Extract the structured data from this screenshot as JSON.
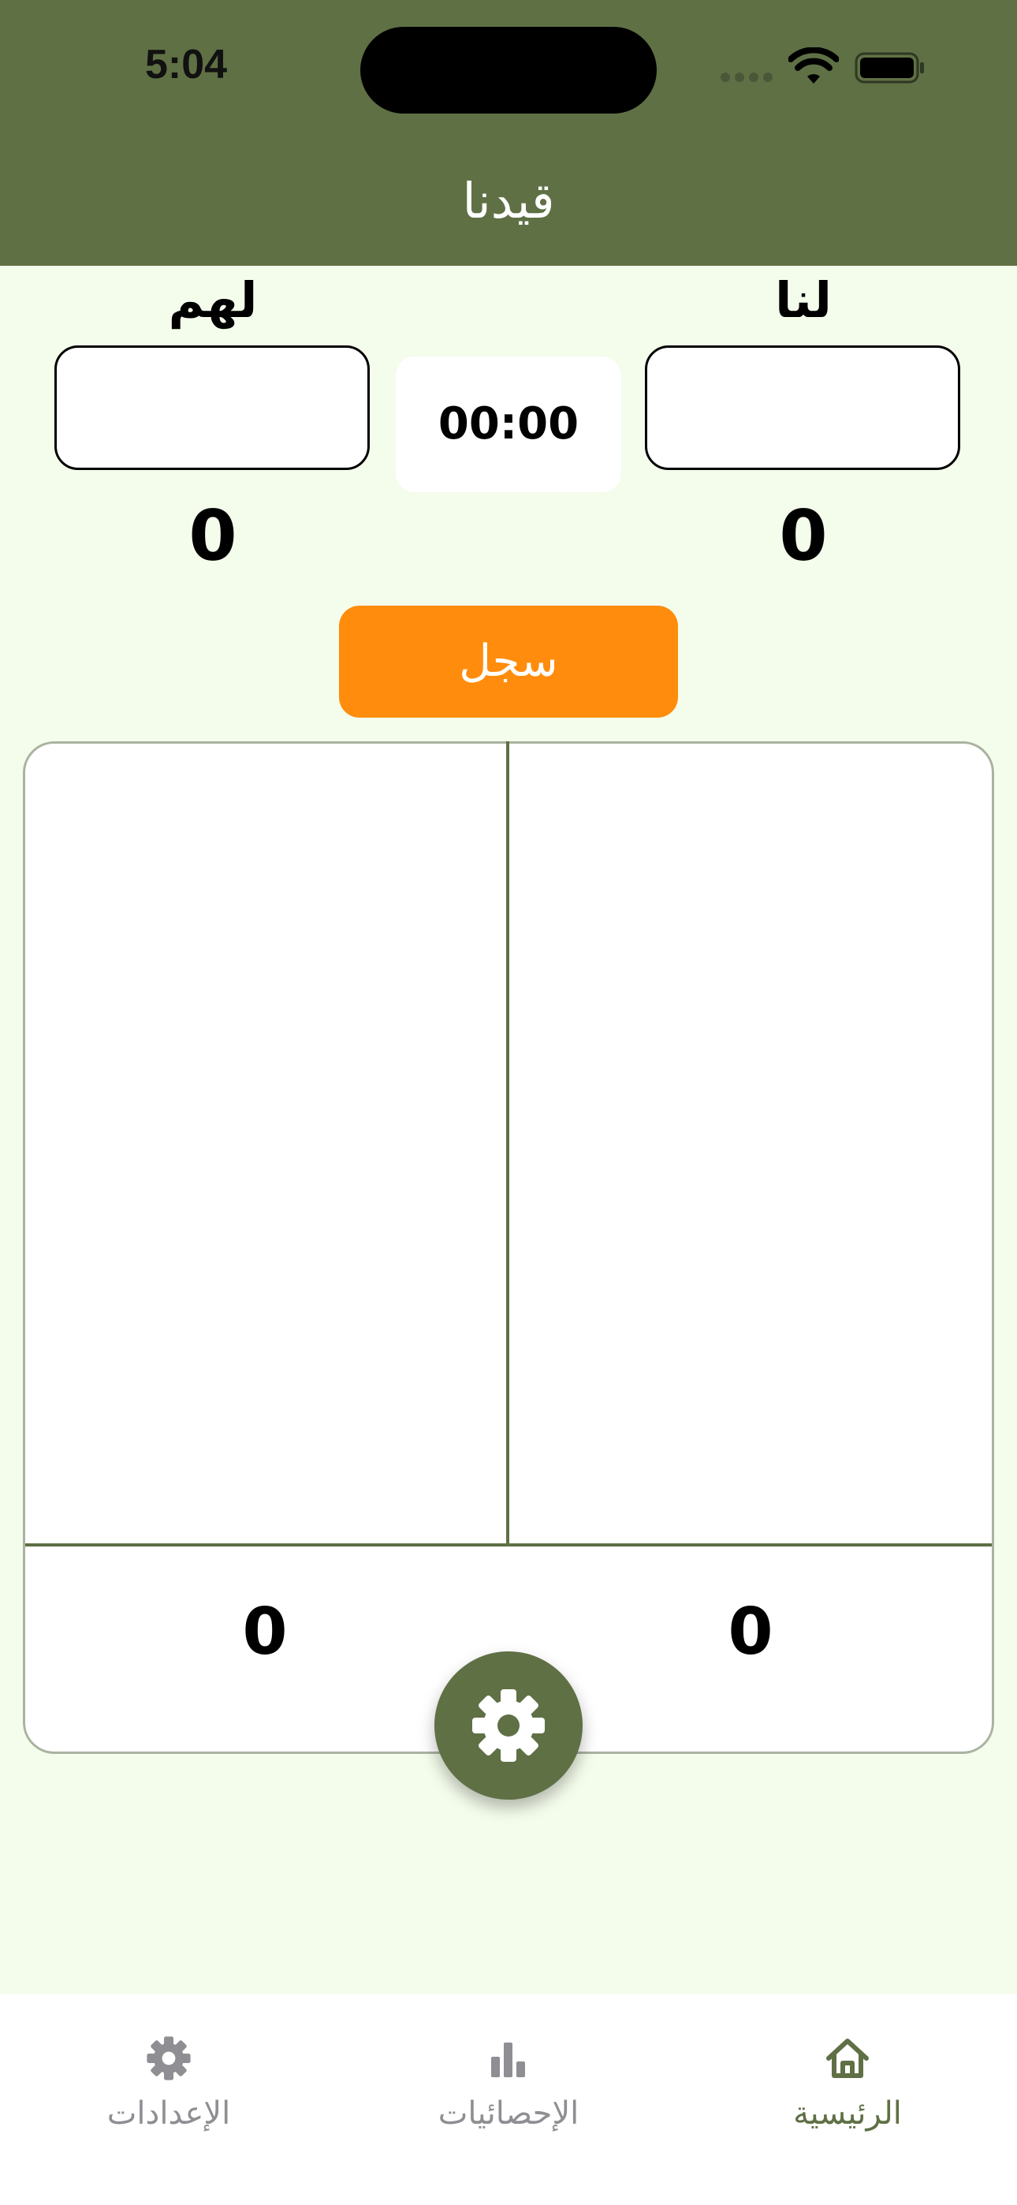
{
  "status_bar": {
    "time": "5:04"
  },
  "header": {
    "title": "قيدنا"
  },
  "teams": {
    "us_label": "لنا",
    "them_label": "لهم",
    "us_score": "0",
    "them_score": "0"
  },
  "timer": {
    "value": "00:00"
  },
  "record_button": {
    "label": "سجل"
  },
  "board": {
    "us_total": "0",
    "them_total": "0"
  },
  "tabs": [
    {
      "label": "الرئيسية",
      "icon": "home-icon",
      "active": true
    },
    {
      "label": "الإحصائيات",
      "icon": "bar-chart-icon",
      "active": false
    },
    {
      "label": "الإعدادات",
      "icon": "gear-icon",
      "active": false
    }
  ],
  "colors": {
    "primary": "#5F7045",
    "accent": "#FF8C0C",
    "background": "#F4FCEB",
    "inactive_tab": "#8E8E93"
  }
}
